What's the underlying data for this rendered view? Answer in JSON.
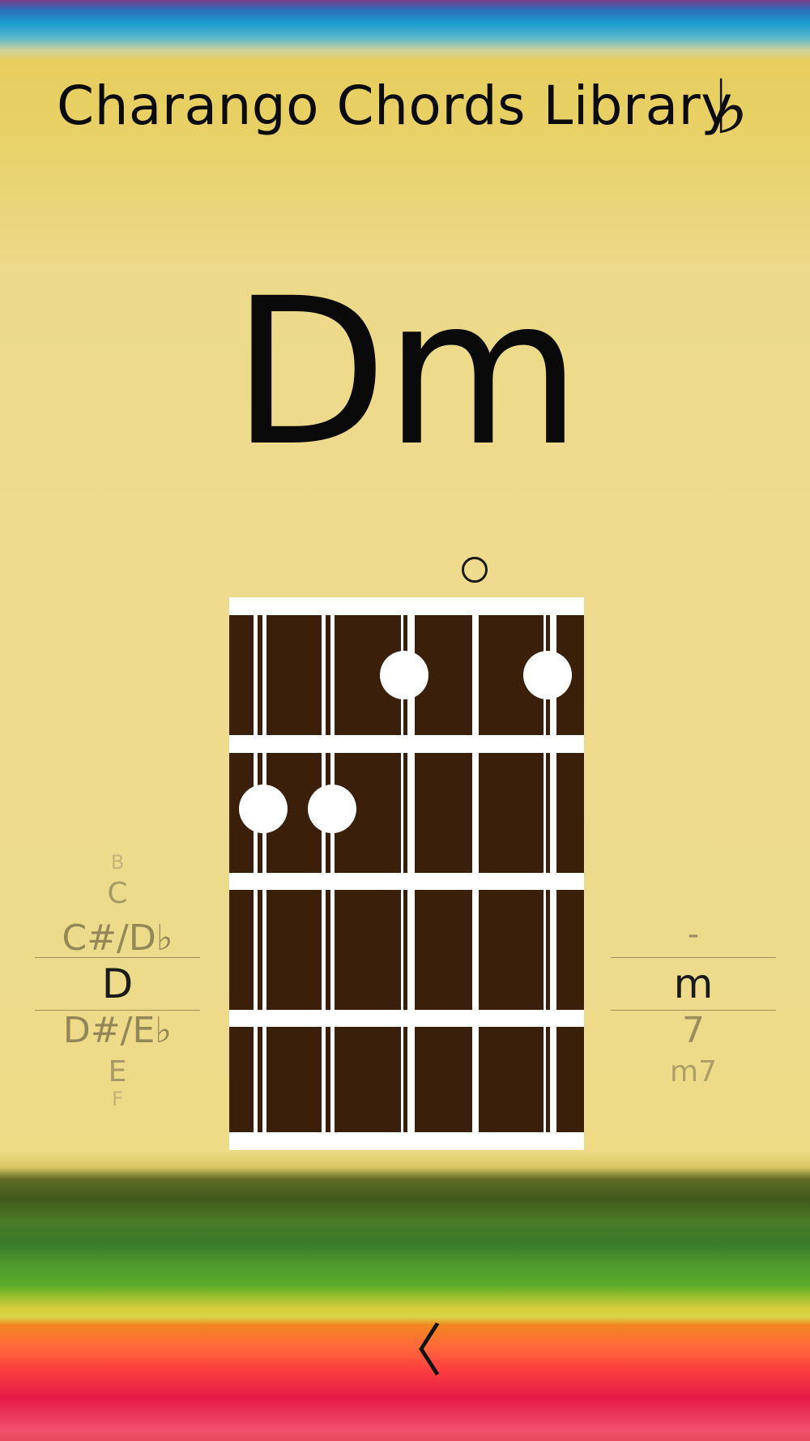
{
  "header": {
    "title": "Charango Chords Library",
    "flat_symbol": "♭"
  },
  "chord": {
    "name": "Dm",
    "open_marker": "○",
    "strings": 5,
    "frets_shown": 4,
    "fingers": [
      {
        "string": 3,
        "fret": 1
      },
      {
        "string": 5,
        "fret": 1
      },
      {
        "string": 1,
        "fret": 2
      },
      {
        "string": 2,
        "fret": 2
      }
    ],
    "open_strings": [
      4
    ]
  },
  "root_picker": {
    "items": [
      "B",
      "C",
      "C#/D♭",
      "D",
      "D#/E♭",
      "E",
      "F"
    ],
    "selected": "D"
  },
  "quality_picker": {
    "items": [
      "-",
      "m",
      "7",
      "m7"
    ],
    "selected": "m"
  },
  "navigation": {
    "back_icon": "chevron-left-icon",
    "back_glyph": "〈"
  },
  "colors": {
    "fretboard_wood": "#3a1f0b",
    "text": "#0b0b0b"
  }
}
